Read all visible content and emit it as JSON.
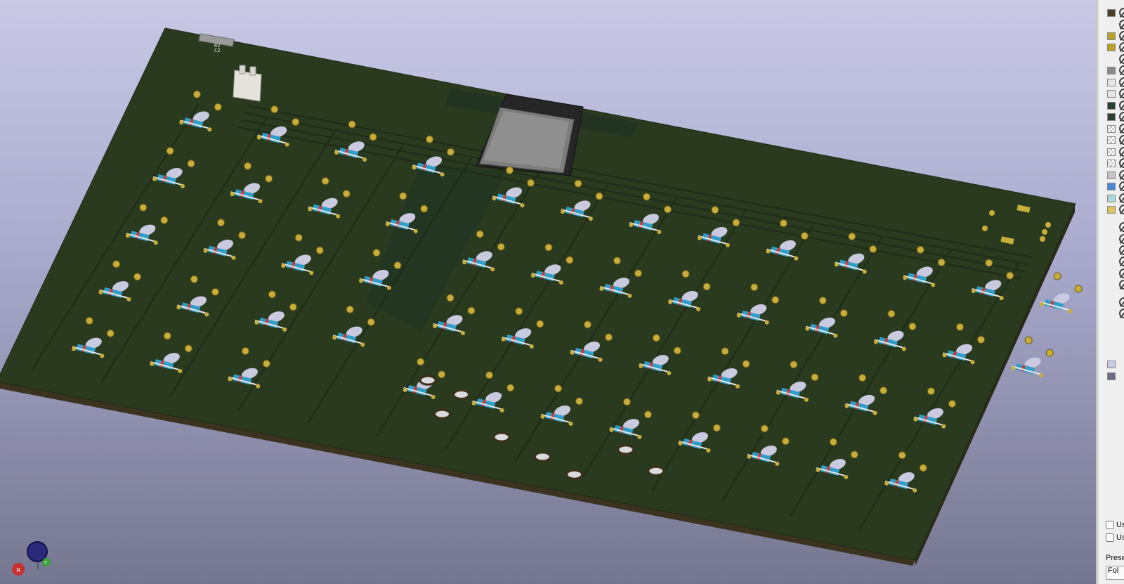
{
  "viewport": {
    "view": "3D Viewer",
    "board": {
      "color": "#2a3a1f",
      "edge_color": "#3b3220",
      "pad_color": "#c9ad3a",
      "switch_count": 53
    },
    "silkscreen_text": [
      "R2",
      "C2"
    ]
  },
  "appearance_panel": {
    "layers": [
      {
        "color": "#4a3f2c",
        "visible": true
      },
      {
        "color": "",
        "visible": true
      },
      {
        "color": "#b9a22a",
        "visible": true
      },
      {
        "color": "#b9a22a",
        "visible": true
      },
      {
        "color": "",
        "visible": true
      },
      {
        "color": "#8a8a8a",
        "visible": true
      },
      {
        "color": "#e6e6e6",
        "visible": true
      },
      {
        "color": "#e6e6e6",
        "visible": true
      },
      {
        "color": "#2b4032",
        "visible": true
      },
      {
        "color": "#2b4032",
        "visible": true
      },
      {
        "color": "checker",
        "visible": true
      },
      {
        "color": "checker",
        "visible": true
      },
      {
        "color": "checker",
        "visible": true
      },
      {
        "color": "checker",
        "visible": true
      },
      {
        "color": "#c4c4c4",
        "visible": true
      },
      {
        "color": "#4a86d6",
        "visible": true
      },
      {
        "color": "#a9dcd2",
        "visible": true
      },
      {
        "color": "#e0c45a",
        "visible": true
      },
      {
        "color": "",
        "visible": true
      },
      {
        "color": "",
        "visible": true
      },
      {
        "color": "",
        "visible": true
      },
      {
        "color": "",
        "visible": true
      },
      {
        "color": "",
        "visible": true
      },
      {
        "color": "",
        "visible": true
      },
      {
        "color": "",
        "visible": true
      },
      {
        "color": "",
        "visible": true
      },
      {
        "color": "#c9cbe6",
        "visible": false
      },
      {
        "color": "#6a6c82",
        "visible": false
      }
    ],
    "checkbox_1": "Use",
    "checkbox_2": "Use",
    "preset_label": "Preset",
    "preset_value": "Fol"
  },
  "axis_gizmo": {
    "colors": {
      "z": "#2a2a7a",
      "x": "#c83030",
      "y": "#3aa13a"
    }
  }
}
